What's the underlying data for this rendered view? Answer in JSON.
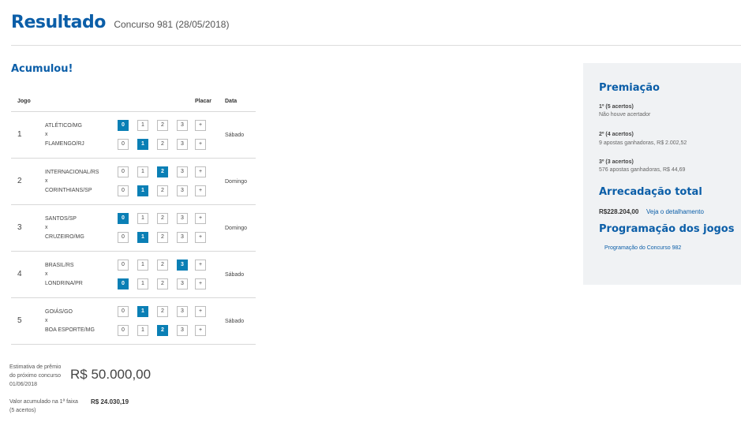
{
  "header": {
    "title": "Resultado",
    "subtitle": "Concurso 981 (28/05/2018)"
  },
  "status": "Acumulou!",
  "table": {
    "headers": {
      "jogo": "Jogo",
      "placar": "Placar",
      "data": "Data"
    },
    "score_options": [
      "0",
      "1",
      "2",
      "3",
      "+"
    ],
    "games": [
      {
        "num": "1",
        "home": "ATLÉTICO/MG",
        "away": "FLAMENGO/RJ",
        "vs": "x",
        "home_score": 0,
        "away_score": 1,
        "date": "Sábado"
      },
      {
        "num": "2",
        "home": "INTERNACIONAL/RS",
        "away": "CORINTHIANS/SP",
        "vs": "x",
        "home_score": 2,
        "away_score": 1,
        "date": "Domingo"
      },
      {
        "num": "3",
        "home": "SANTOS/SP",
        "away": "CRUZEIRO/MG",
        "vs": "x",
        "home_score": 0,
        "away_score": 1,
        "date": "Domingo"
      },
      {
        "num": "4",
        "home": "BRASIL/RS",
        "away": "LONDRINA/PR",
        "vs": "x",
        "home_score": 3,
        "away_score": 0,
        "date": "Sábado"
      },
      {
        "num": "5",
        "home": "GOIÁS/GO",
        "away": "BOA ESPORTE/MG",
        "vs": "x",
        "home_score": 1,
        "away_score": 2,
        "date": "Sábado"
      }
    ]
  },
  "estimativa": {
    "label_line1": "Estimativa de prêmio",
    "label_line2": "do próximo concurso",
    "label_line3": "01/06/2018",
    "value": "R$ 50.000,00"
  },
  "acumulado": {
    "label_line1": "Valor acumulado na 1ª faixa",
    "label_line2": "(5 acertos)",
    "value": "R$ 24.030,19"
  },
  "sidebar": {
    "premiacao_title": "Premiação",
    "prizes": [
      {
        "title": "1º (5 acertos)",
        "desc": "Não houve acertador"
      },
      {
        "title": "2º (4 acertos)",
        "desc": "9 apostas ganhadoras, R$ 2.002,52"
      },
      {
        "title": "3º (3 acertos)",
        "desc": "576 apostas ganhadoras, R$ 44,69"
      }
    ],
    "arrecadacao_title": "Arrecadação total",
    "arrecadacao_value": "R$228.204,00",
    "arrecadacao_link": "Veja o detalhamento",
    "programacao_title": "Programação dos jogos",
    "programacao_link": "Programação do Concurso 982"
  },
  "colors": {
    "brand_blue": "#0b5ea8",
    "selected_box": "#0a7fb5",
    "sidebar_bg": "#f0f2f4"
  }
}
